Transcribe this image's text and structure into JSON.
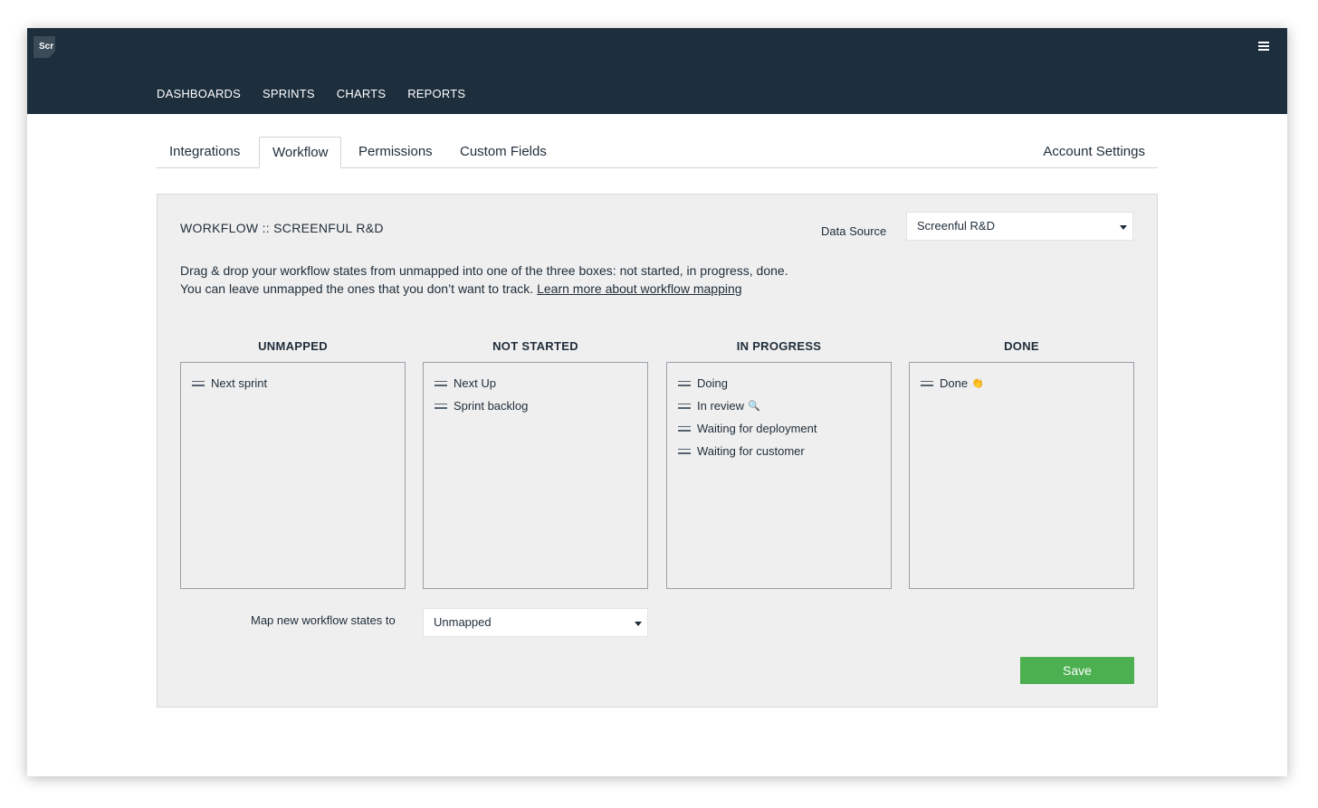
{
  "app": {
    "logo_text": "Scr",
    "menu_icon": "hamburger-icon",
    "nav": [
      "DASHBOARDS",
      "SPRINTS",
      "CHARTS",
      "REPORTS"
    ]
  },
  "tabs": {
    "items": [
      "Integrations",
      "Workflow",
      "Permissions",
      "Custom Fields"
    ],
    "active": "Workflow",
    "account": "Account Settings"
  },
  "workflow": {
    "title": "WORKFLOW :: SCREENFUL R&D",
    "data_source_label": "Data Source",
    "data_source_value": "Screenful R&D",
    "description_line1": "Drag & drop your workflow states from unmapped into one of the three boxes: not started, in progress, done.",
    "description_line2": "You can leave unmapped the ones that you don’t want to track.",
    "learn_more": "Learn more about workflow mapping",
    "columns": [
      {
        "title": "UNMAPPED",
        "states": [
          {
            "label": "Next sprint",
            "emoji": ""
          }
        ]
      },
      {
        "title": "NOT STARTED",
        "states": [
          {
            "label": "Next Up",
            "emoji": ""
          },
          {
            "label": "Sprint backlog",
            "emoji": ""
          }
        ]
      },
      {
        "title": "IN PROGRESS",
        "states": [
          {
            "label": "Doing",
            "emoji": ""
          },
          {
            "label": "In review",
            "emoji": "🔍"
          },
          {
            "label": "Waiting for deployment",
            "emoji": ""
          },
          {
            "label": "Waiting for customer",
            "emoji": ""
          }
        ]
      },
      {
        "title": "DONE",
        "states": [
          {
            "label": "Done",
            "emoji": "👏"
          }
        ]
      }
    ],
    "map_new_label": "Map new workflow states to",
    "map_new_value": "Unmapped",
    "save_label": "Save",
    "save_color": "#4caf50"
  }
}
